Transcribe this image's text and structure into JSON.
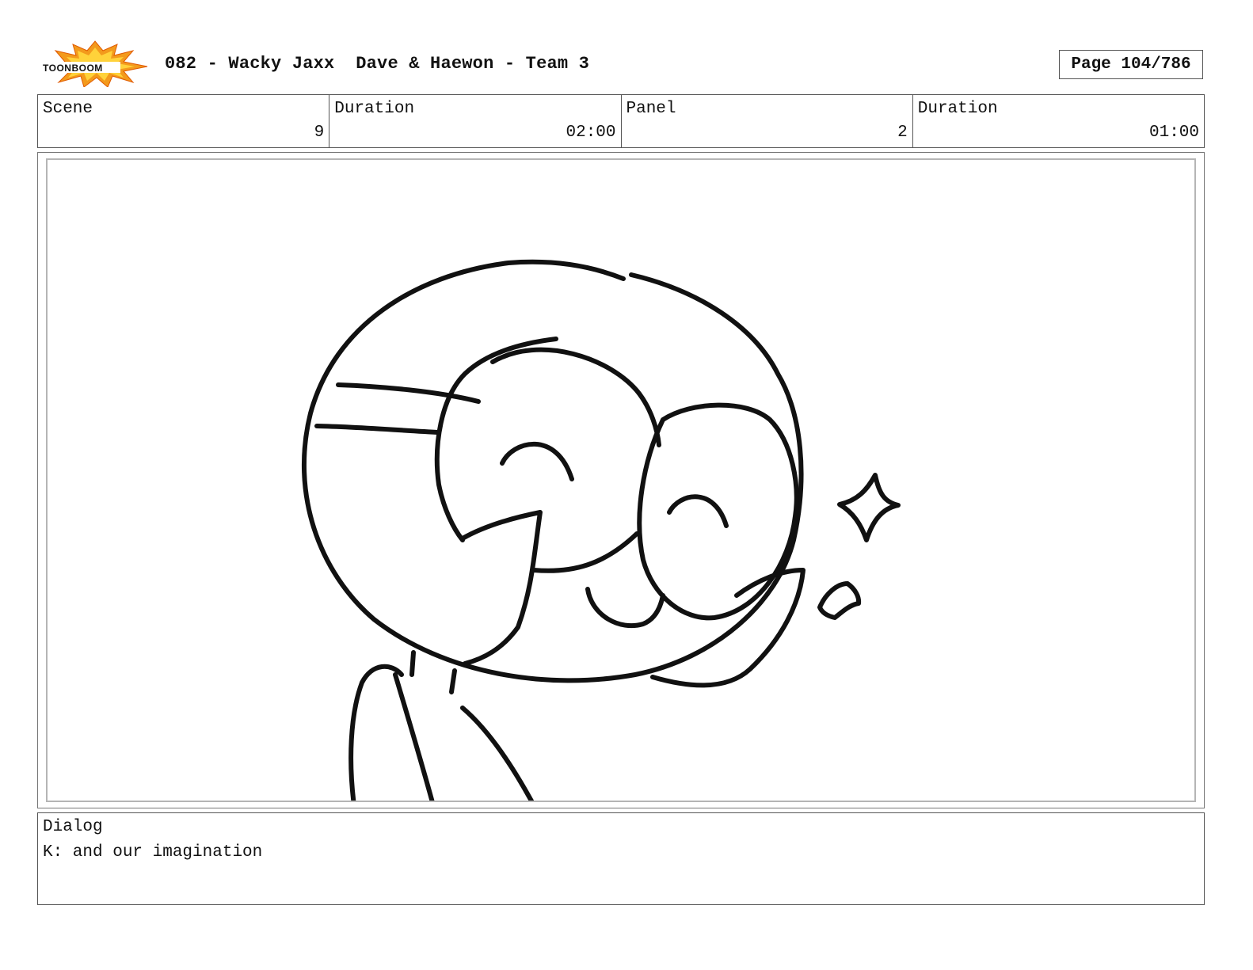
{
  "header": {
    "logo": {
      "icon": "toon-boom-logo",
      "text": "TOONBOOM"
    },
    "title": "082 - Wacky Jaxx  Dave & Haewon - Team 3",
    "page": "Page 104/786"
  },
  "info": {
    "scene_label": "Scene",
    "scene_value": "9",
    "scene_duration_label": "Duration",
    "scene_duration_value": "02:00",
    "panel_label": "Panel",
    "panel_value": "2",
    "panel_duration_label": "Duration",
    "panel_duration_value": "01:00"
  },
  "drawing": {
    "icon": "storyboard-sketch",
    "description": "",
    "colors": {
      "ink": "#111111",
      "frame": "#b5b5b5"
    }
  },
  "dialog": {
    "label": "Dialog",
    "text": "K: and our imagination"
  }
}
